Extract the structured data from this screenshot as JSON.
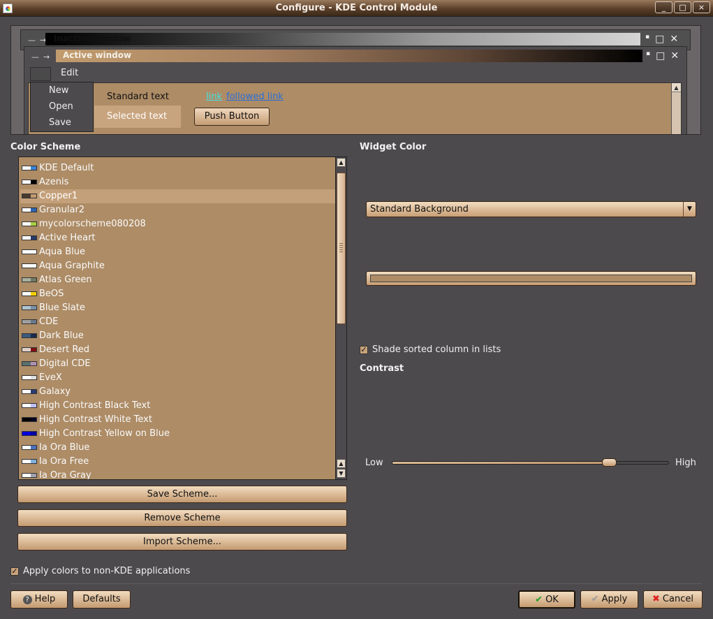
{
  "window": {
    "title": "Configure - KDE Control Module",
    "controls": [
      "_",
      "□",
      "×"
    ]
  },
  "preview": {
    "inactive_title": "Inactive window",
    "active_title": "Active window",
    "menu_edit": "Edit",
    "popup_items": [
      "New",
      "Open",
      "Save"
    ],
    "standard_text": "Standard text",
    "selected_text": "Selected text",
    "link": "link",
    "followed_link": "followed link",
    "push_button": "Push Button"
  },
  "color_scheme": {
    "label": "Color Scheme",
    "selected": "Copper1",
    "items": [
      {
        "label": "KDE Default",
        "colors": [
          "#ffffff",
          "#3c82d8"
        ]
      },
      {
        "label": "Azenis",
        "colors": [
          "#ffffff",
          "#000000"
        ]
      },
      {
        "label": "Copper1",
        "colors": [
          "#4a3a2e",
          "#c29a70"
        ]
      },
      {
        "label": "Granular2",
        "colors": [
          "#ffffff",
          "#2e64b4"
        ]
      },
      {
        "label": "mycolorscheme080208",
        "colors": [
          "#ffffff",
          "#a8d040"
        ]
      },
      {
        "label": "Active Heart",
        "colors": [
          "#ffffff",
          "#2a3a6a"
        ]
      },
      {
        "label": "Aqua Blue",
        "colors": [
          "#ffffff",
          "#ffffff"
        ]
      },
      {
        "label": "Aqua Graphite",
        "colors": [
          "#ffffff",
          "#ffffff"
        ]
      },
      {
        "label": "Atlas Green",
        "colors": [
          "#aab0a0",
          "#707a60"
        ]
      },
      {
        "label": "BeOS",
        "colors": [
          "#ffffff",
          "#f8d000"
        ]
      },
      {
        "label": "Blue Slate",
        "colors": [
          "#b0c4d0",
          "#7a90a8"
        ]
      },
      {
        "label": "CDE",
        "colors": [
          "#a0a0a0",
          "#6a7a8a"
        ]
      },
      {
        "label": "Dark Blue",
        "colors": [
          "#3a5a80",
          "#1a2a4a"
        ]
      },
      {
        "label": "Desert Red",
        "colors": [
          "#e0d0c8",
          "#801010"
        ]
      },
      {
        "label": "Digital CDE",
        "colors": [
          "#5a7070",
          "#b090b0"
        ]
      },
      {
        "label": "EveX",
        "colors": [
          "#ffffff",
          "#e0e0e0"
        ]
      },
      {
        "label": "Galaxy",
        "colors": [
          "#ffffff",
          "#2a3a70"
        ]
      },
      {
        "label": "High Contrast Black Text",
        "colors": [
          "#ffffff",
          "#c0c0ff"
        ]
      },
      {
        "label": "High Contrast White Text",
        "colors": [
          "#000000",
          "#000020"
        ]
      },
      {
        "label": "High Contrast Yellow on Blue",
        "colors": [
          "#0000e0",
          "#0000a0"
        ]
      },
      {
        "label": "Ia Ora Blue",
        "colors": [
          "#ffffff",
          "#4a70c0"
        ]
      },
      {
        "label": "Ia Ora Free",
        "colors": [
          "#ffffff",
          "#80b0e0"
        ]
      },
      {
        "label": "Ia Ora Gray",
        "colors": [
          "#ffffff",
          "#a0a0b0"
        ]
      }
    ],
    "save_button": "Save Scheme...",
    "remove_button": "Remove Scheme",
    "import_button": "Import Scheme..."
  },
  "widget_color": {
    "label": "Widget Color",
    "combo_value": "Standard Background",
    "swatch_color": "#ad8c66"
  },
  "shade_sorted": {
    "label": "Shade sorted column in lists",
    "checked": true
  },
  "contrast": {
    "label": "Contrast",
    "low": "Low",
    "high": "High",
    "level": 0.79
  },
  "apply_non_kde": {
    "label": "Apply colors to non-KDE applications",
    "checked": true
  },
  "footer": {
    "help": "Help",
    "defaults": "Defaults",
    "ok": "OK",
    "apply": "Apply",
    "cancel": "Cancel"
  },
  "theme": {
    "accent": "#ad8c66",
    "background": "#4d4a4d"
  }
}
